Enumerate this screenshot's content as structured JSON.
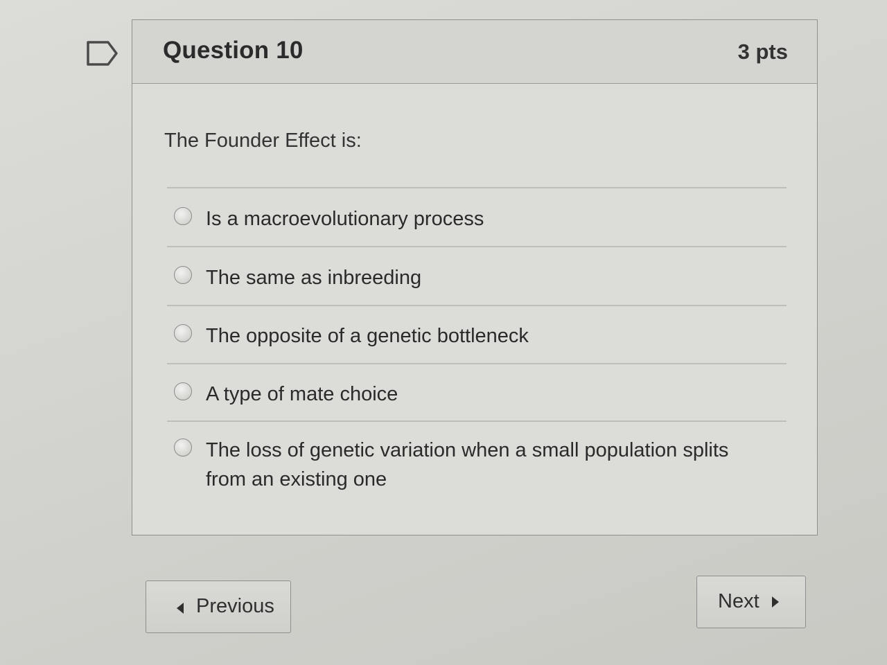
{
  "question": {
    "flag_icon": "flag-icon",
    "title": "Question 10",
    "points": "3 pts",
    "prompt": "The Founder Effect is:",
    "answers": [
      {
        "label": "Is a macroevolutionary process"
      },
      {
        "label": "The same as inbreeding"
      },
      {
        "label": "The opposite of a genetic bottleneck"
      },
      {
        "label": "A type of mate choice"
      },
      {
        "label": "The loss of genetic variation when a small population splits from an existing one"
      }
    ]
  },
  "navigation": {
    "previous_label": "Previous",
    "next_label": "Next",
    "previous_icon": "caret-left-icon",
    "next_icon": "caret-right-icon"
  }
}
